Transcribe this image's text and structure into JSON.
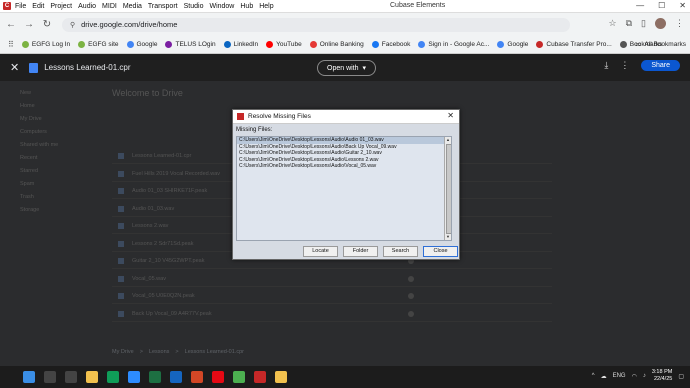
{
  "app": {
    "menu_items": [
      "File",
      "Edit",
      "Project",
      "Audio",
      "MIDI",
      "Media",
      "Transport",
      "Studio",
      "Window",
      "Hub",
      "Help"
    ],
    "title": "Cubase Elements",
    "win_controls": [
      "—",
      "☐",
      "✕"
    ]
  },
  "browser": {
    "url": "drive.google.com/drive/home",
    "bookmarks": [
      {
        "label": "EGFG Log In",
        "color": "#7cb342"
      },
      {
        "label": "EGFG site",
        "color": "#7cb342"
      },
      {
        "label": "Google",
        "color": "#4285f4"
      },
      {
        "label": "TELUS LOgin",
        "color": "#7b1fa2"
      },
      {
        "label": "LinkedIn",
        "color": "#0a66c2"
      },
      {
        "label": "YouTube",
        "color": "#ff0000"
      },
      {
        "label": "Online Banking",
        "color": "#e53935"
      },
      {
        "label": "Facebook",
        "color": "#1877f2"
      },
      {
        "label": "Sign in - Google Ac...",
        "color": "#4285f4"
      },
      {
        "label": "Google",
        "color": "#4285f4"
      },
      {
        "label": "Cubase Transfer Pro...",
        "color": "#c62828"
      },
      {
        "label": "Bookmarks",
        "color": "#555555"
      }
    ],
    "all_bookmarks": "All Bookmarks"
  },
  "viewer": {
    "filename": "Lessons Learned-01.cpr",
    "open_with": "Open with",
    "share": "Share"
  },
  "drive_bg": {
    "welcome": "Welcome to Drive",
    "sidebar": [
      "New",
      "Home",
      "My Drive",
      "Computers",
      "Shared with me",
      "Recent",
      "Starred",
      "Spam",
      "Trash",
      "Storage"
    ],
    "rows": [
      "Lessons Learned-01.cpr",
      "Fuel Hills 2019 Vocal Recorded.wav",
      "Audio 01_03 SHIRKE71F.peak",
      "Audio 01_03.wav",
      "Lessons 2.wav",
      "Lessons 2 Sdr71Sd.peak",
      "Guitar 2_10 V45G2WPT.peak",
      "Vocal_05.wav",
      "Vocal_05 U0E0Q2N.peak",
      "Back Up Vocal_09 A4R77V.peak"
    ],
    "crumb": [
      "My Drive",
      ">",
      "Lessons",
      ">",
      "Lessons Learned-01.cpr"
    ]
  },
  "dialog": {
    "title": "Resolve Missing Files",
    "label": "Missing Files:",
    "files": [
      "C:\\Users\\Jim\\OneDrive\\Desktop\\Lessons\\Audio\\Audio 01_03.wav",
      "C:\\Users\\Jim\\OneDrive\\Desktop\\Lessons\\Audio\\Back Up Vocal_09.wav",
      "C:\\Users\\Jim\\OneDrive\\Desktop\\Lessons\\Audio\\Guitar 2_10.wav",
      "C:\\Users\\Jim\\OneDrive\\Desktop\\Lessons\\Audio\\Lessons 2.wav",
      "C:\\Users\\Jim\\OneDrive\\Desktop\\Lessons\\Audio\\Vocal_05.wav"
    ],
    "selected_index": 0,
    "buttons": [
      "Locate",
      "Folder",
      "Search",
      "Close"
    ]
  },
  "taskbar": {
    "apps": [
      {
        "icon": "start-icon",
        "color": "#3a8ee6"
      },
      {
        "icon": "search-icon",
        "color": "#444444"
      },
      {
        "icon": "taskview-icon",
        "color": "#444444"
      },
      {
        "icon": "explorer-icon",
        "color": "#f2c14e"
      },
      {
        "icon": "edge-icon",
        "color": "#0f9d58"
      },
      {
        "icon": "zoom-icon",
        "color": "#2d8cff"
      },
      {
        "icon": "excel-icon",
        "color": "#1d6f42"
      },
      {
        "icon": "mail-icon",
        "color": "#1565c0"
      },
      {
        "icon": "powerpoint-icon",
        "color": "#d24726"
      },
      {
        "icon": "netflix-icon",
        "color": "#e50914"
      },
      {
        "icon": "chrome-icon",
        "color": "#4caf50"
      },
      {
        "icon": "cubase-icon",
        "color": "#c62828"
      },
      {
        "icon": "folder-icon",
        "color": "#f2c14e"
      }
    ],
    "lang": "ENG",
    "time": "3:18 PM",
    "date": "22/4/25"
  }
}
